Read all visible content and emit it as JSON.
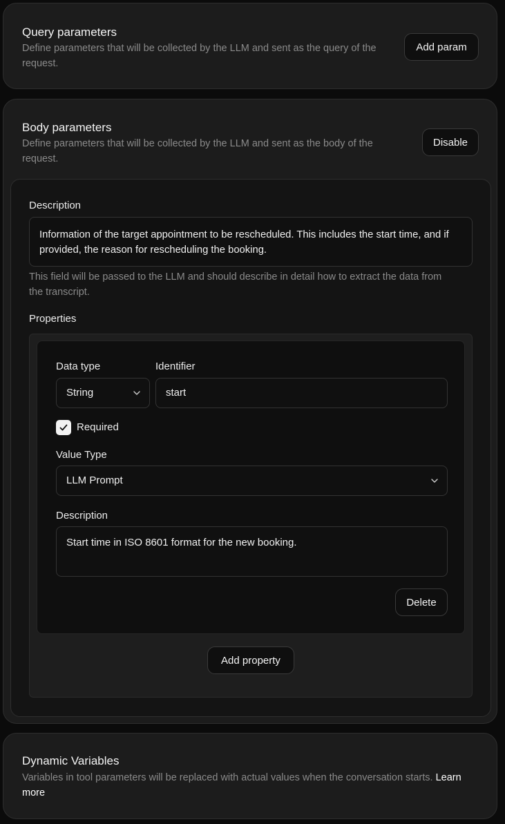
{
  "query": {
    "title": "Query parameters",
    "description": "Define parameters that will be collected by the LLM and sent as the query of the request.",
    "button": "Add param"
  },
  "body": {
    "title": "Body parameters",
    "description": "Define parameters that will be collected by the LLM and sent as the body of the request.",
    "button": "Disable",
    "description_label": "Description",
    "description_value": "Information of the target appointment to be rescheduled. This includes the start time, and if provided, the reason for rescheduling the booking.",
    "description_hint": "This field will be passed to the LLM and should describe in detail how to extract the data from the transcript.",
    "properties_label": "Properties",
    "property": {
      "data_type_label": "Data type",
      "data_type_value": "String",
      "identifier_label": "Identifier",
      "identifier_value": "start",
      "required_label": "Required",
      "required_checked": true,
      "value_type_label": "Value Type",
      "value_type_value": "LLM Prompt",
      "description_label": "Description",
      "description_value": "Start time in ISO 8601 format for the new booking.",
      "delete_button": "Delete"
    },
    "add_property_button": "Add property"
  },
  "dynamic": {
    "title": "Dynamic Variables",
    "description": "Variables in tool parameters will be replaced with actual values when the conversation starts.",
    "learn_more": "Learn more"
  },
  "icons": {
    "select_chevron": "chevron-down-icon",
    "checkbox_check": "check-icon"
  }
}
